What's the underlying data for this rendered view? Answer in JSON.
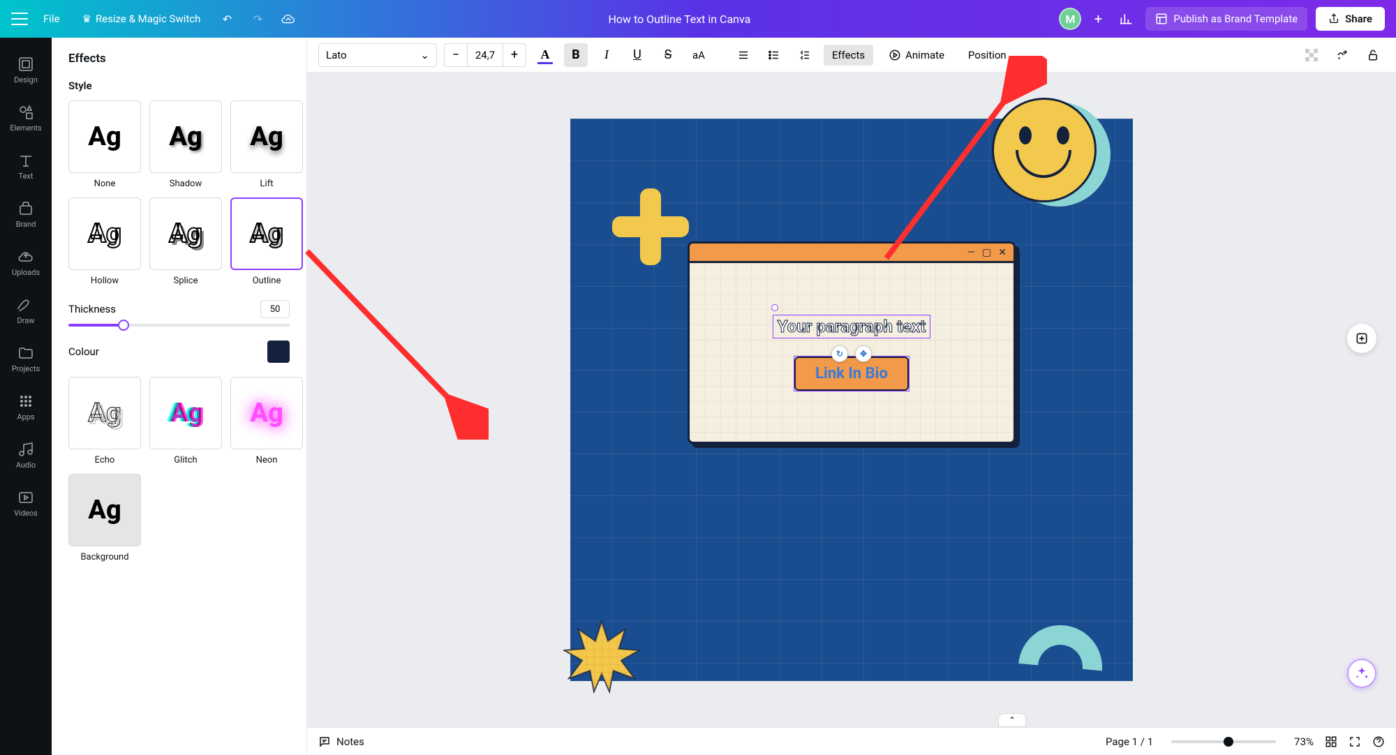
{
  "topbar": {
    "file": "File",
    "resize": "Resize & Magic Switch",
    "title": "How to Outline Text in Canva",
    "avatar_initial": "M",
    "publish": "Publish as Brand Template",
    "share": "Share"
  },
  "nav": {
    "design": "Design",
    "elements": "Elements",
    "text": "Text",
    "brand": "Brand",
    "uploads": "Uploads",
    "draw": "Draw",
    "projects": "Projects",
    "apps": "Apps",
    "audio": "Audio",
    "videos": "Videos"
  },
  "panel": {
    "title": "Effects",
    "style_label": "Style",
    "styles": {
      "none": "None",
      "shadow": "Shadow",
      "lift": "Lift",
      "hollow": "Hollow",
      "splice": "Splice",
      "outline": "Outline",
      "echo": "Echo",
      "glitch": "Glitch",
      "neon": "Neon",
      "background": "Background"
    },
    "thickness_label": "Thickness",
    "thickness_value": "50",
    "colour_label": "Colour",
    "colour_value": "#14213d"
  },
  "toolbar": {
    "font": "Lato",
    "size": "24,7",
    "effects": "Effects",
    "animate": "Animate",
    "position": "Position"
  },
  "canvas": {
    "paragraph": "Your paragraph text",
    "link": "Link In Bio"
  },
  "bottombar": {
    "notes": "Notes",
    "page_indicator": "Page 1 / 1",
    "zoom": "73%"
  }
}
